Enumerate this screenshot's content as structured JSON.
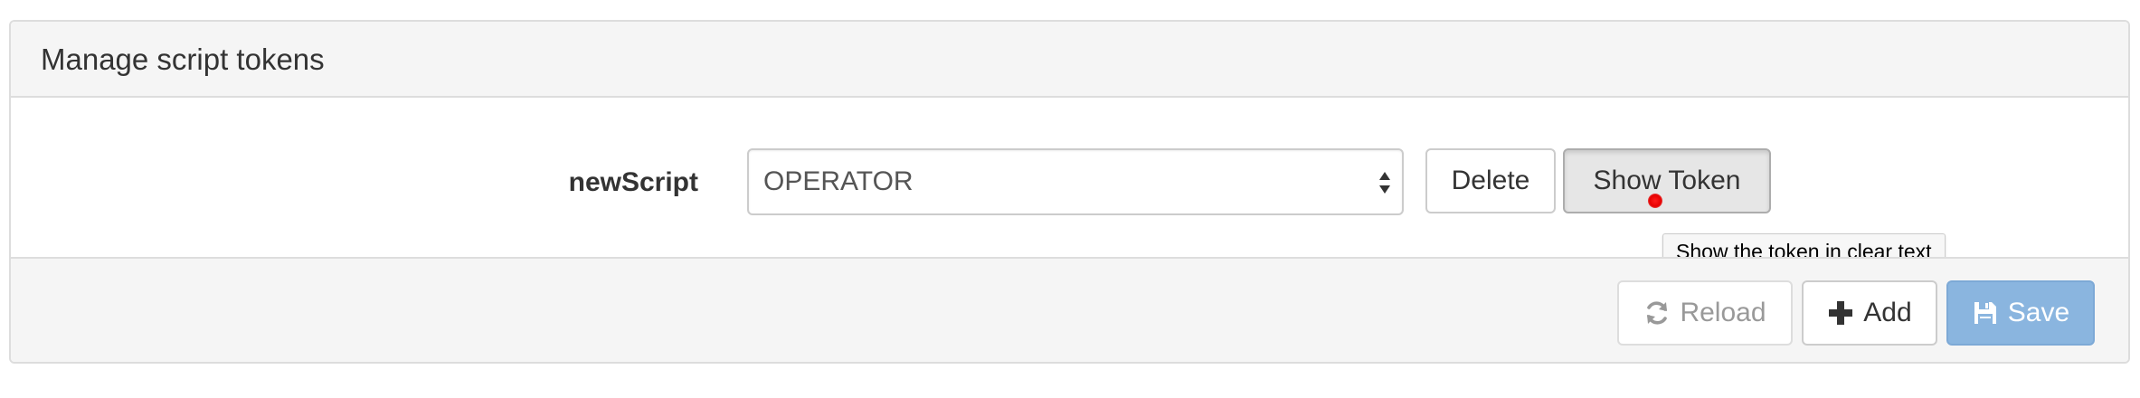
{
  "panel": {
    "title": "Manage script tokens"
  },
  "token_row": {
    "script_name": "newScript",
    "role_select": {
      "selected": "OPERATOR"
    },
    "delete_label": "Delete",
    "show_token_label": "Show Token",
    "tooltip_text": "Show the token in clear text"
  },
  "footer": {
    "reload_label": "Reload",
    "reload_icon": "refresh-icon",
    "add_label": "Add",
    "add_icon": "plus-icon",
    "save_label": "Save",
    "save_icon": "floppy-disk-icon"
  },
  "colors": {
    "save_button": "#8ab5df",
    "cursor_marker": "#e60000"
  }
}
